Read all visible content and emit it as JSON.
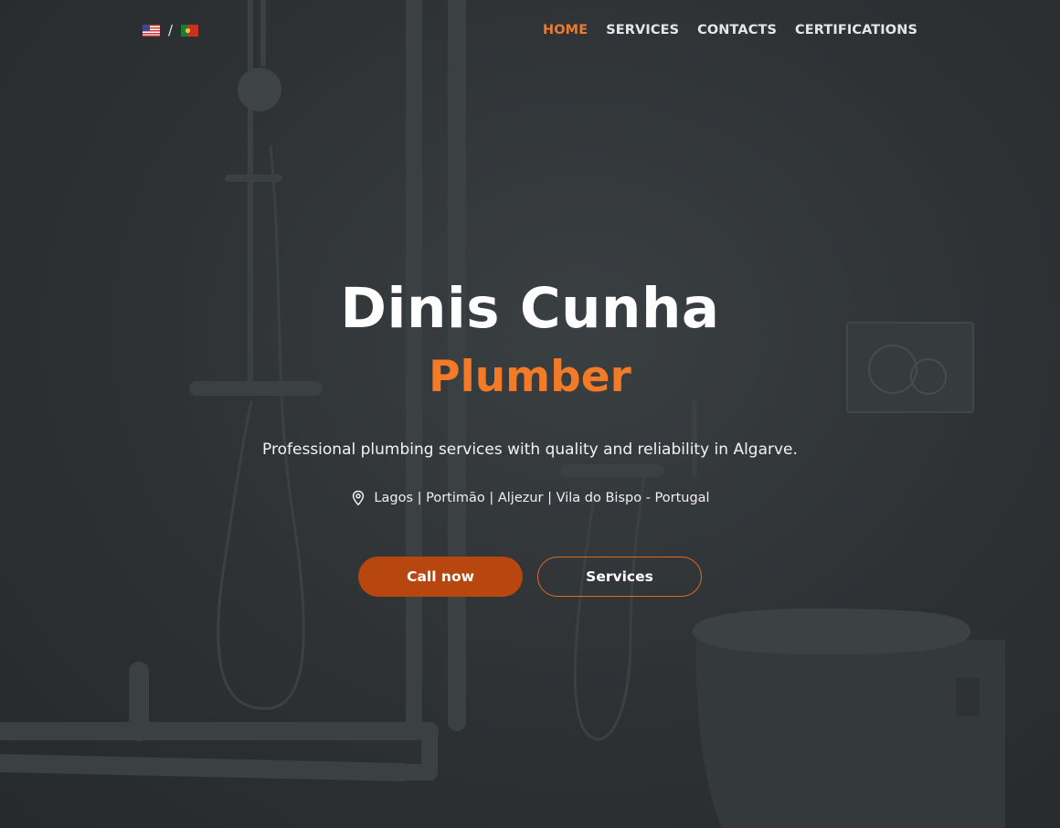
{
  "language": {
    "separator": "/",
    "options": [
      {
        "code": "en",
        "icon": "us-flag-icon"
      },
      {
        "code": "pt",
        "icon": "portugal-flag-icon"
      }
    ]
  },
  "nav": {
    "items": [
      {
        "label": "HOME",
        "active": true
      },
      {
        "label": "SERVICES",
        "active": false
      },
      {
        "label": "CONTACTS",
        "active": false
      },
      {
        "label": "CERTIFICATIONS",
        "active": false
      }
    ]
  },
  "hero": {
    "name": "Dinis Cunha",
    "profession": "Plumber",
    "tagline": "Professional plumbing services with quality and reliability in Algarve.",
    "location": "Lagos | Portimão | Aljezur | Vila do Bispo - Portugal",
    "location_icon": "map-pin-icon",
    "call_button": "Call now",
    "services_button": "Services"
  },
  "colors": {
    "accent": "#f37a26",
    "button_fill": "#b8470f",
    "background": "#2c3032"
  }
}
